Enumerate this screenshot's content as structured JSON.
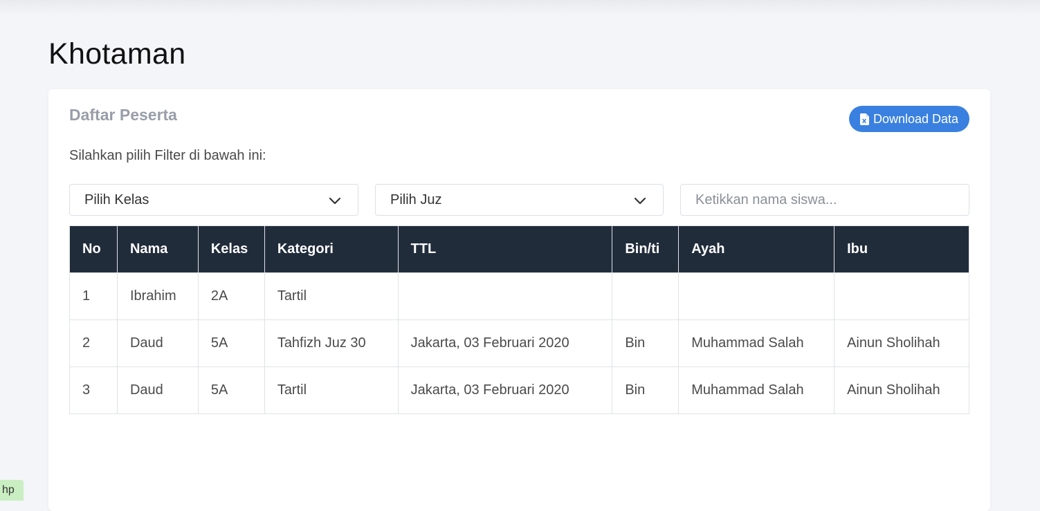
{
  "page": {
    "title": "Khotaman"
  },
  "card": {
    "title": "Daftar Peserta",
    "download_label": "Download Data",
    "filter_instruction": "Silahkan pilih Filter di bawah ini:"
  },
  "filters": {
    "kelas_selected": "Pilih Kelas",
    "juz_selected": "Pilih Juz",
    "search_placeholder": "Ketikkan nama siswa..."
  },
  "table": {
    "headers": [
      "No",
      "Nama",
      "Kelas",
      "Kategori",
      "TTL",
      "Bin/ti",
      "Ayah",
      "Ibu"
    ],
    "rows": [
      [
        "1",
        "Ibrahim",
        "2A",
        "Tartil",
        "",
        "",
        "",
        ""
      ],
      [
        "2",
        "Daud",
        "5A",
        "Tahfizh Juz 30",
        "Jakarta, 03 Februari 2020",
        "Bin",
        "Muhammad Salah",
        "Ainun Sholihah"
      ],
      [
        "3",
        "Daud",
        "5A",
        "Tartil",
        "Jakarta, 03 Februari 2020",
        "Bin",
        "Muhammad Salah",
        "Ainun Sholihah"
      ]
    ]
  },
  "corner_tag": "hp",
  "colors": {
    "accent": "#3a80e0",
    "table_header": "#212c3b",
    "background": "#f4f5f9"
  },
  "icons": {
    "download": "file-excel-icon",
    "dropdown": "chevron-down-icon"
  }
}
